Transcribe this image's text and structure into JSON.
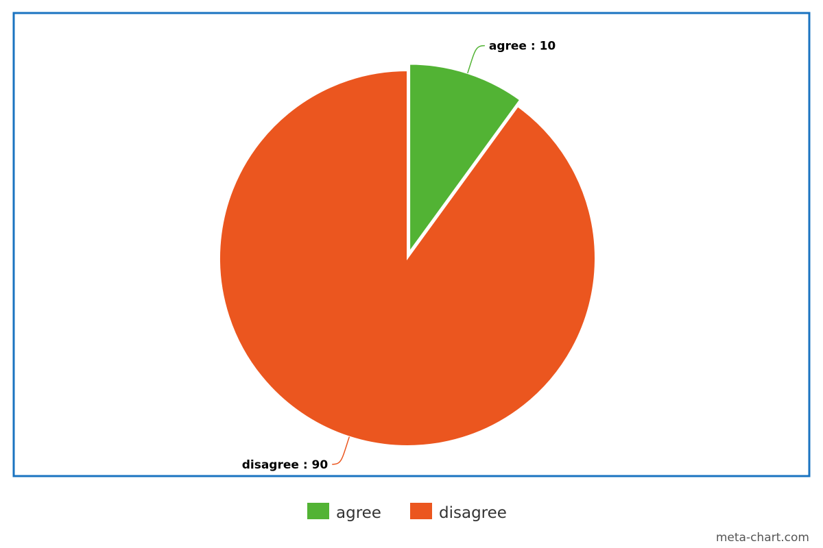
{
  "chart_data": {
    "type": "pie",
    "title": "",
    "slices": [
      {
        "label": "agree",
        "value": 10,
        "color": "#52b334",
        "exploded": true
      },
      {
        "label": "disagree",
        "value": 90,
        "color": "#eb561f",
        "exploded": false
      }
    ],
    "data_labels": [
      "agree : 10",
      "disagree : 90"
    ],
    "start_angle": "12 o'clock",
    "direction": "clockwise",
    "legend": {
      "position": "bottom-center",
      "entries": [
        "agree",
        "disagree"
      ]
    }
  },
  "frame_color": "#1a73c0",
  "credit": "meta-chart.com"
}
